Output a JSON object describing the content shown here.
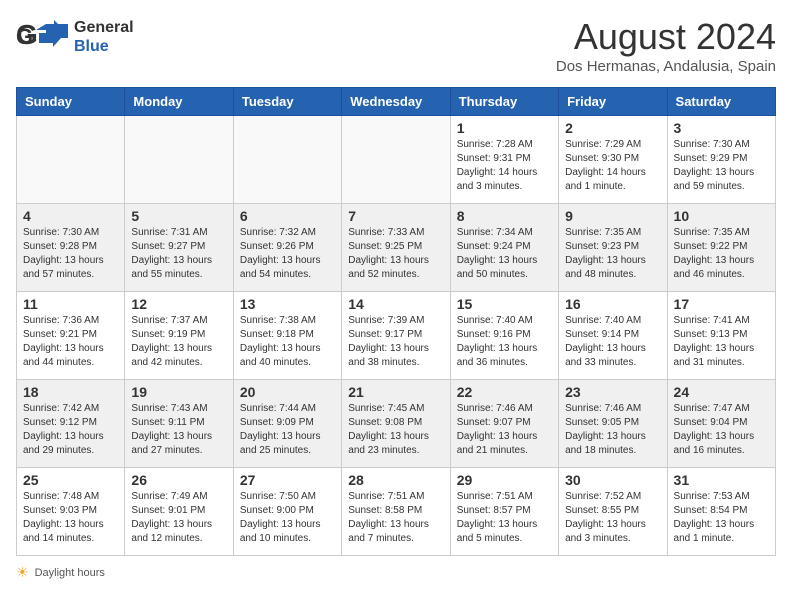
{
  "header": {
    "logo_general": "General",
    "logo_blue": "Blue",
    "month_year": "August 2024",
    "location": "Dos Hermanas, Andalusia, Spain"
  },
  "days_of_week": [
    "Sunday",
    "Monday",
    "Tuesday",
    "Wednesday",
    "Thursday",
    "Friday",
    "Saturday"
  ],
  "weeks": [
    [
      {
        "num": "",
        "info": "",
        "empty": true
      },
      {
        "num": "",
        "info": "",
        "empty": true
      },
      {
        "num": "",
        "info": "",
        "empty": true
      },
      {
        "num": "",
        "info": "",
        "empty": true
      },
      {
        "num": "1",
        "info": "Sunrise: 7:28 AM\nSunset: 9:31 PM\nDaylight: 14 hours\nand 3 minutes.",
        "empty": false
      },
      {
        "num": "2",
        "info": "Sunrise: 7:29 AM\nSunset: 9:30 PM\nDaylight: 14 hours\nand 1 minute.",
        "empty": false
      },
      {
        "num": "3",
        "info": "Sunrise: 7:30 AM\nSunset: 9:29 PM\nDaylight: 13 hours\nand 59 minutes.",
        "empty": false
      }
    ],
    [
      {
        "num": "4",
        "info": "Sunrise: 7:30 AM\nSunset: 9:28 PM\nDaylight: 13 hours\nand 57 minutes.",
        "empty": false
      },
      {
        "num": "5",
        "info": "Sunrise: 7:31 AM\nSunset: 9:27 PM\nDaylight: 13 hours\nand 55 minutes.",
        "empty": false
      },
      {
        "num": "6",
        "info": "Sunrise: 7:32 AM\nSunset: 9:26 PM\nDaylight: 13 hours\nand 54 minutes.",
        "empty": false
      },
      {
        "num": "7",
        "info": "Sunrise: 7:33 AM\nSunset: 9:25 PM\nDaylight: 13 hours\nand 52 minutes.",
        "empty": false
      },
      {
        "num": "8",
        "info": "Sunrise: 7:34 AM\nSunset: 9:24 PM\nDaylight: 13 hours\nand 50 minutes.",
        "empty": false
      },
      {
        "num": "9",
        "info": "Sunrise: 7:35 AM\nSunset: 9:23 PM\nDaylight: 13 hours\nand 48 minutes.",
        "empty": false
      },
      {
        "num": "10",
        "info": "Sunrise: 7:35 AM\nSunset: 9:22 PM\nDaylight: 13 hours\nand 46 minutes.",
        "empty": false
      }
    ],
    [
      {
        "num": "11",
        "info": "Sunrise: 7:36 AM\nSunset: 9:21 PM\nDaylight: 13 hours\nand 44 minutes.",
        "empty": false
      },
      {
        "num": "12",
        "info": "Sunrise: 7:37 AM\nSunset: 9:19 PM\nDaylight: 13 hours\nand 42 minutes.",
        "empty": false
      },
      {
        "num": "13",
        "info": "Sunrise: 7:38 AM\nSunset: 9:18 PM\nDaylight: 13 hours\nand 40 minutes.",
        "empty": false
      },
      {
        "num": "14",
        "info": "Sunrise: 7:39 AM\nSunset: 9:17 PM\nDaylight: 13 hours\nand 38 minutes.",
        "empty": false
      },
      {
        "num": "15",
        "info": "Sunrise: 7:40 AM\nSunset: 9:16 PM\nDaylight: 13 hours\nand 36 minutes.",
        "empty": false
      },
      {
        "num": "16",
        "info": "Sunrise: 7:40 AM\nSunset: 9:14 PM\nDaylight: 13 hours\nand 33 minutes.",
        "empty": false
      },
      {
        "num": "17",
        "info": "Sunrise: 7:41 AM\nSunset: 9:13 PM\nDaylight: 13 hours\nand 31 minutes.",
        "empty": false
      }
    ],
    [
      {
        "num": "18",
        "info": "Sunrise: 7:42 AM\nSunset: 9:12 PM\nDaylight: 13 hours\nand 29 minutes.",
        "empty": false
      },
      {
        "num": "19",
        "info": "Sunrise: 7:43 AM\nSunset: 9:11 PM\nDaylight: 13 hours\nand 27 minutes.",
        "empty": false
      },
      {
        "num": "20",
        "info": "Sunrise: 7:44 AM\nSunset: 9:09 PM\nDaylight: 13 hours\nand 25 minutes.",
        "empty": false
      },
      {
        "num": "21",
        "info": "Sunrise: 7:45 AM\nSunset: 9:08 PM\nDaylight: 13 hours\nand 23 minutes.",
        "empty": false
      },
      {
        "num": "22",
        "info": "Sunrise: 7:46 AM\nSunset: 9:07 PM\nDaylight: 13 hours\nand 21 minutes.",
        "empty": false
      },
      {
        "num": "23",
        "info": "Sunrise: 7:46 AM\nSunset: 9:05 PM\nDaylight: 13 hours\nand 18 minutes.",
        "empty": false
      },
      {
        "num": "24",
        "info": "Sunrise: 7:47 AM\nSunset: 9:04 PM\nDaylight: 13 hours\nand 16 minutes.",
        "empty": false
      }
    ],
    [
      {
        "num": "25",
        "info": "Sunrise: 7:48 AM\nSunset: 9:03 PM\nDaylight: 13 hours\nand 14 minutes.",
        "empty": false
      },
      {
        "num": "26",
        "info": "Sunrise: 7:49 AM\nSunset: 9:01 PM\nDaylight: 13 hours\nand 12 minutes.",
        "empty": false
      },
      {
        "num": "27",
        "info": "Sunrise: 7:50 AM\nSunset: 9:00 PM\nDaylight: 13 hours\nand 10 minutes.",
        "empty": false
      },
      {
        "num": "28",
        "info": "Sunrise: 7:51 AM\nSunset: 8:58 PM\nDaylight: 13 hours\nand 7 minutes.",
        "empty": false
      },
      {
        "num": "29",
        "info": "Sunrise: 7:51 AM\nSunset: 8:57 PM\nDaylight: 13 hours\nand 5 minutes.",
        "empty": false
      },
      {
        "num": "30",
        "info": "Sunrise: 7:52 AM\nSunset: 8:55 PM\nDaylight: 13 hours\nand 3 minutes.",
        "empty": false
      },
      {
        "num": "31",
        "info": "Sunrise: 7:53 AM\nSunset: 8:54 PM\nDaylight: 13 hours\nand 1 minute.",
        "empty": false
      }
    ]
  ],
  "footer": {
    "daylight_label": "Daylight hours"
  }
}
